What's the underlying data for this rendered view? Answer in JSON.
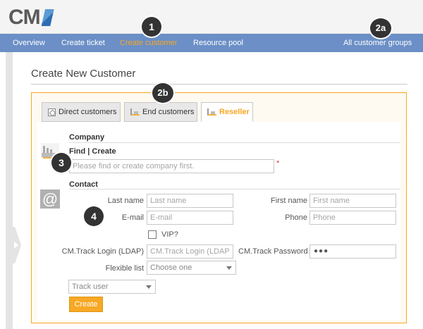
{
  "logo": {
    "text": "CM"
  },
  "nav": {
    "items": [
      {
        "label": "Overview"
      },
      {
        "label": "Create ticket"
      },
      {
        "label": "Create customer",
        "active": true
      },
      {
        "label": "Resource pool"
      }
    ],
    "right": "All customer groups"
  },
  "badges": {
    "b1": "1",
    "b2a": "2a",
    "b2b": "2b",
    "b3": "3",
    "b4": "4"
  },
  "page": {
    "title": "Create New Customer"
  },
  "tabs": [
    {
      "label": "Direct customers",
      "icon": "diamond-icon"
    },
    {
      "label": "End customers",
      "icon": "factory-icon"
    },
    {
      "label": "Reseller",
      "icon": "factory-icon",
      "active": true
    }
  ],
  "company": {
    "heading": "Company",
    "find_create": "Find | Create",
    "placeholder": "Please find or create company first.",
    "required": "*"
  },
  "contact": {
    "heading": "Contact",
    "last_name": {
      "label": "Last name",
      "placeholder": "Last name"
    },
    "first_name": {
      "label": "First name",
      "placeholder": "First name"
    },
    "email": {
      "label": "E-mail",
      "placeholder": "E-mail"
    },
    "phone": {
      "label": "Phone",
      "placeholder": "Phone"
    },
    "vip": {
      "label": "VIP?"
    },
    "login": {
      "label": "CM.Track Login (LDAP)",
      "placeholder": "CM.Track Login (LDAP)"
    },
    "password": {
      "label": "CM.Track Password",
      "value": "●●●"
    },
    "flexible": {
      "label": "Flexible list",
      "value": "Choose one"
    },
    "track_user": {
      "value": "Track user"
    }
  },
  "actions": {
    "create": "Create"
  },
  "colors": {
    "accent": "#f7a824",
    "nav_bg": "#6b8fc6"
  }
}
